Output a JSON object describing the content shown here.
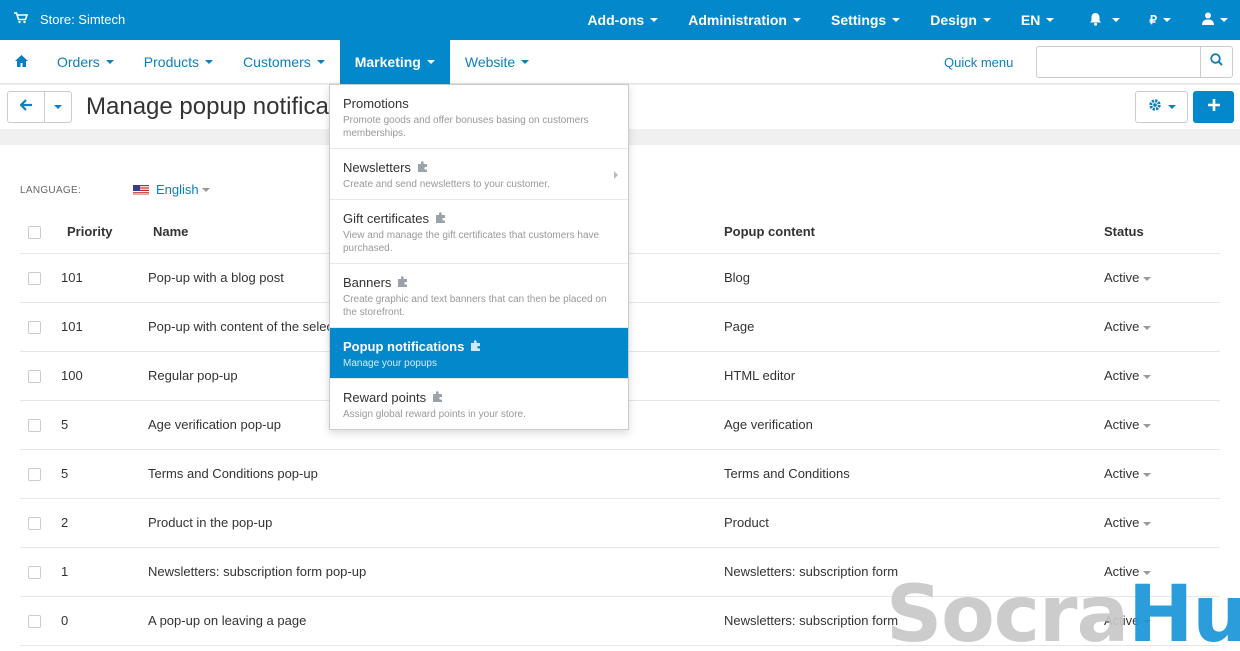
{
  "topbar": {
    "store": "Store: Simtech",
    "items": [
      "Add-ons",
      "Administration",
      "Settings",
      "Design",
      "EN"
    ],
    "currency": "₽"
  },
  "nav": {
    "tabs": [
      "Orders",
      "Products",
      "Customers",
      "Marketing",
      "Website"
    ],
    "active_tab": "Marketing",
    "quick_menu": "Quick menu",
    "search_placeholder": ""
  },
  "page": {
    "title": "Manage popup notifications"
  },
  "language": {
    "label": "LANGUAGE:",
    "value": "English"
  },
  "table": {
    "headers": [
      "Priority",
      "Name",
      "Popup content",
      "Status"
    ],
    "rows": [
      {
        "priority": "101",
        "name": "Pop-up with a blog post",
        "content": "Blog",
        "status": "Active"
      },
      {
        "priority": "101",
        "name": "Pop-up with content of the selected page",
        "content": "Page",
        "status": "Active"
      },
      {
        "priority": "100",
        "name": "Regular pop-up",
        "content": "HTML editor",
        "status": "Active"
      },
      {
        "priority": "5",
        "name": "Age verification pop-up",
        "content": "Age verification",
        "status": "Active"
      },
      {
        "priority": "5",
        "name": "Terms and Conditions pop-up",
        "content": "Terms and Conditions",
        "status": "Active"
      },
      {
        "priority": "2",
        "name": "Product in the pop-up",
        "content": "Product",
        "status": "Active"
      },
      {
        "priority": "1",
        "name": "Newsletters: subscription form pop-up",
        "content": "Newsletters: subscription form",
        "status": "Active"
      },
      {
        "priority": "0",
        "name": "A pop-up on leaving a page",
        "content": "Newsletters: subscription form",
        "status": "Active"
      }
    ]
  },
  "marketing_menu": [
    {
      "title": "Promotions",
      "desc": "Promote goods and offer bonuses basing on customers memberships."
    },
    {
      "title": "Newsletters",
      "desc": "Create and send newsletters to your customer."
    },
    {
      "title": "Gift certificates",
      "desc": "View and manage the gift certificates that customers have purchased."
    },
    {
      "title": "Banners",
      "desc": "Create graphic and text banners that can then be placed on the storefront."
    },
    {
      "title": "Popup notifications",
      "desc": "Manage your popups"
    },
    {
      "title": "Reward points",
      "desc": "Assign global reward points in your store."
    }
  ],
  "watermark": {
    "part1": "Socra",
    "part2": "Hub"
  },
  "colors": {
    "primary": "#0388cc",
    "link": "#0b7fc0",
    "watermark_blue": "#1b95d8"
  },
  "icons": [
    "cart-icon",
    "home-icon",
    "search-icon",
    "arrow-left-icon",
    "gear-icon",
    "plus-icon",
    "bell-icon",
    "user-icon",
    "puzzle-icon"
  ]
}
